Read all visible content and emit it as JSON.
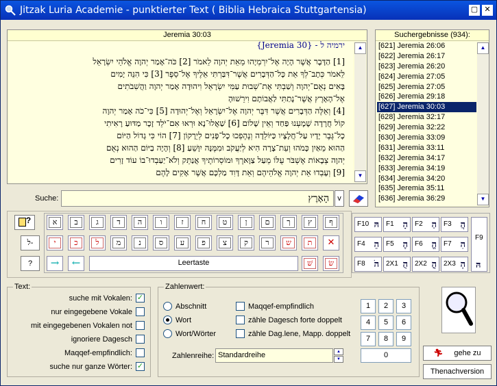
{
  "window": {
    "title": "Jitzak Luria Academie - punktierter Text ( Biblia Hebraica Stuttgartensia)"
  },
  "text_panel": {
    "header": "Jeremia 30:03",
    "ref_line": "ירמיה ל - {Jeremia 30}",
    "lines": [
      "[1] הַדָּבָר אֲשֶׁר הָיָה אֶל־יִרְמְיָהוּ מֵאֵת יְהוָה לֵאמֹר [2] כֹּה־אָמַר יְהוָה אֱלֹהֵי יִשְׂרָאֵל",
      "לֵאמֹר כְּתָב־לְךָ אֵת כָּל־הַדְּבָרִים אֲשֶׁר־דִּבַּרְתִּי אֵלֶיךָ אֶל־סֵפֶר [3] כִּי הִנֵּה יָמִים",
      "בָּאִים נְאֻם־יְהוָה וְשַׁבְתִּי אֶת־שְׁבוּת עַמִּי יִשְׂרָאֵל וִיהוּדָה אָמַר יְהוָה וַהֲשִׁבֹתִים",
      "אֶל־הָאָרֶץ אֲשֶׁר־נָתַתִּי לַאֲבוֹתָם וִירֵשׁוּהָ",
      "[4] וְאֵלֶּה הַדְּבָרִים אֲשֶׁר דִּבֶּר יְהוָה אֶל־יִשְׂרָאֵל וְאֶל־יְהוּדָה [5] כִּי־כֹה אָמַר יְהוָה",
      "קוֹל חֲרָדָה שָׁמָעְנוּ פַּחַד וְאֵין שָׁלוֹם [6] שַׁאֲלוּ־נָא וּרְאוּ אִם־יֹלֵד זָכָר מַדּוּעַ רָאִיתִי",
      "כָל־גֶּבֶר יָדָיו עַל־חֲלָצָיו כַּיּוֹלֵדָה וְנֶהֶפְכוּ כָל־פָּנִים לְיֵרָקוֹן [7] הוֹי כִּי גָדוֹל הַיּוֹם",
      "הַהוּא מֵאַיִן כָּמֹהוּ וְעֵת־צָרָה הִיא לְיַעֲקֹב וּמִמֶּנָּה יִוָּשֵׁעַ [8] וְהָיָה בַיּוֹם הַהוּא נְאֻם",
      "יְהוָה צְבָאוֹת אֶשְׁבֹּר עֻלּוֹ מֵעַל צַוָּארֶךָ וּמוֹסְרוֹתֶיךָ אֲנַתֵּק וְלֹא־יַעַבְדוּ־בוֹ עוֹד זָרִים",
      "[9] וְעָבְדוּ אֵת יְהוָה אֱלֹהֵיהֶם וְאֵת דָּוִד מַלְכָּם אֲשֶׁר אָקִים לָהֶם"
    ]
  },
  "results_panel": {
    "header": "Suchergebnisse (934):",
    "items": [
      "[621] Jeremia 26:06",
      "[622] Jeremia 26:17",
      "[623] Jeremia 26:20",
      "[624] Jeremia 27:05",
      "[625] Jeremia 27:05",
      "[626] Jeremia 29:18",
      "[627] Jeremia 30:03",
      "[628] Jeremia 32:17",
      "[629] Jeremia 32:22",
      "[630] Jeremia 33:09",
      "[631] Jeremia 33:11",
      "[632] Jeremia 34:17",
      "[633] Jeremia 34:19",
      "[634] Jeremia 34:20",
      "[635] Jeremia 35:11",
      "[636] Jeremia 36:29"
    ],
    "selected": 6
  },
  "search": {
    "label": "Suche:",
    "value": "הָאָרֶץ",
    "v_label": "v"
  },
  "keyboard": {
    "row1": [
      "ף",
      "ץ",
      "ך",
      "ם",
      "ן",
      "ט",
      "ח",
      "ז",
      "ו",
      "ה",
      "ד",
      "ג",
      "ב",
      "א"
    ],
    "row2": [
      "ת",
      "ש",
      "ר",
      "ק",
      "צ",
      "פ",
      "ע",
      "ס",
      "נ",
      "מ",
      "ל",
      "כ",
      "י"
    ],
    "space_label": "Leertaste",
    "shin1": "שׁ",
    "shin2": "שׂ",
    "left_q": "?",
    "left_arrow": "←",
    "left_back": "ל-",
    "delete": "✕",
    "arrow_right": "→",
    "arrow_left": "←"
  },
  "fkeys": [
    {
      "k": "F10",
      "c": "הּ"
    },
    {
      "k": "F1",
      "c": "הָ"
    },
    {
      "k": "F2",
      "c": "הַ"
    },
    {
      "k": "F3",
      "c": "הֲ"
    },
    {
      "k": "F4",
      "c": "הֵ"
    },
    {
      "k": "F5",
      "c": "הֶ"
    },
    {
      "k": "F6",
      "c": "הֱ"
    },
    {
      "k": "F7",
      "c": "הִ"
    },
    {
      "k": "F8",
      "c": "הֹ"
    },
    {
      "k": "2X1",
      "c": "הֻ"
    },
    {
      "k": "2X2",
      "c": "הֳ"
    },
    {
      "k": "2X3",
      "c": "הְ"
    },
    {
      "k": "F9",
      "c": "הּ"
    }
  ],
  "text_group": {
    "title": "Text:",
    "options": [
      {
        "label": "suche mit Vokalen:",
        "checked": true
      },
      {
        "label": "nur eingegebene Vokale",
        "checked": false
      },
      {
        "label": "mit eingegebenen Vokalen not",
        "checked": false
      },
      {
        "label": "ignoriere Dagesch",
        "checked": false
      },
      {
        "label": "Maqqef-empfindlich:",
        "checked": false
      },
      {
        "label": "suche nur ganze Wörter:",
        "checked": true
      }
    ]
  },
  "zahlen_group": {
    "title": "Zahlenwert:",
    "radios": [
      {
        "label": "Abschnitt",
        "on": false
      },
      {
        "label": "Wort",
        "on": true
      },
      {
        "label": "Wort/Wörter",
        "on": false
      }
    ],
    "checks": [
      {
        "label": "Maqqef-empfindlich",
        "checked": false
      },
      {
        "label": "zähle Dagesch forte doppelt",
        "checked": false
      },
      {
        "label": "zähle Dag.lene, Mapp. doppelt",
        "checked": false
      }
    ],
    "reihe_label": "Zahlenreihe:",
    "reihe_value": "Standardreihe"
  },
  "numpad": [
    "1",
    "2",
    "3",
    "4",
    "5",
    "6",
    "7",
    "8",
    "9",
    "0"
  ],
  "buttons": {
    "goto": "gehe zu",
    "thenach": "Thenachversion"
  }
}
